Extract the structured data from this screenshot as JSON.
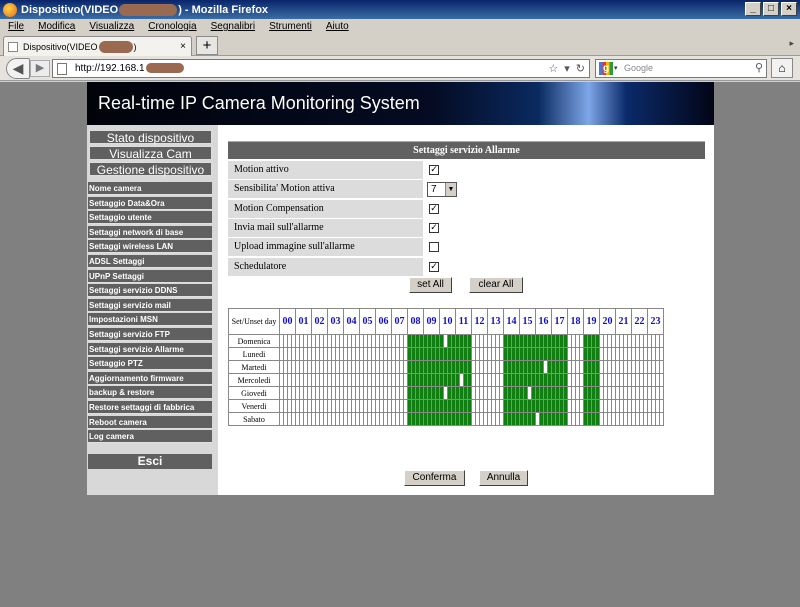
{
  "browser": {
    "title_prefix": "Dispositivo(VIDEO",
    "title_suffix": ") - Mozilla Firefox",
    "menu": [
      "File",
      "Modifica",
      "Visualizza",
      "Cronologia",
      "Segnalibri",
      "Strumenti",
      "Aiuto"
    ],
    "tab_label_prefix": "Dispositivo(VIDEO",
    "tab_label_suffix": ")",
    "newtab": "+",
    "url": "http://192.168.1",
    "search_placeholder": "Google"
  },
  "banner_title": "Real-time IP Camera Monitoring System",
  "sidebar": {
    "main_buttons": [
      "Stato dispositivo",
      "Visualizza Cam",
      "Gestione dispositivo"
    ],
    "items": [
      "Nome camera",
      "Settaggio Data&Ora",
      "Settaggio utente",
      "Settaggi network di base",
      "Settaggi wireless LAN",
      "ADSL Settaggi",
      "UPnP Settaggi",
      "Settaggi servizio DDNS",
      "Settaggi servizio mail",
      "Impostazioni MSN",
      "Settaggi servizio FTP",
      "Settaggi servizio Allarme",
      "Settaggio PTZ",
      "Aggiornamento firmware",
      "backup & restore",
      "Restore settaggi di fabbrica",
      "Reboot camera",
      "Log camera"
    ],
    "exit": "Esci"
  },
  "form": {
    "header": "Settaggi servizio Allarme",
    "rows": [
      {
        "label": "Motion attivo",
        "type": "checkbox",
        "checked": true
      },
      {
        "label": "Sensibilita' Motion attiva",
        "type": "select",
        "value": "7"
      },
      {
        "label": "Motion Compensation",
        "type": "checkbox",
        "checked": true
      },
      {
        "label": "Invia mail sull'allarme",
        "type": "checkbox",
        "checked": true
      },
      {
        "label": "Upload immagine sull'allarme",
        "type": "checkbox",
        "checked": false
      },
      {
        "label": "Schedulatore",
        "type": "checkbox",
        "checked": true
      }
    ],
    "set_all": "set All",
    "clear_all": "clear All",
    "confirm": "Conferma",
    "cancel": "Annulla"
  },
  "schedule": {
    "corner_label": "Set/Unset day",
    "hours": [
      "00",
      "01",
      "02",
      "03",
      "04",
      "05",
      "06",
      "07",
      "08",
      "09",
      "10",
      "11",
      "12",
      "13",
      "14",
      "15",
      "16",
      "17",
      "18",
      "19",
      "20",
      "21",
      "22",
      "23"
    ],
    "active_color": "#107e10",
    "days": [
      {
        "name": "Domenica",
        "active_hours": [
          8,
          9,
          10,
          11,
          14,
          15,
          16,
          17,
          19
        ],
        "unset_slots": [
          41
        ]
      },
      {
        "name": "Lunedi",
        "active_hours": [
          8,
          9,
          10,
          11,
          14,
          15,
          16,
          17,
          19
        ],
        "unset_slots": []
      },
      {
        "name": "Martedi",
        "active_hours": [
          8,
          9,
          10,
          11,
          14,
          15,
          16,
          17,
          19
        ],
        "unset_slots": [
          66
        ]
      },
      {
        "name": "Mercoledi",
        "active_hours": [
          8,
          9,
          10,
          11,
          14,
          15,
          16,
          17,
          19
        ],
        "unset_slots": [
          45
        ]
      },
      {
        "name": "Giovedi",
        "active_hours": [
          8,
          9,
          10,
          11,
          14,
          15,
          16,
          17,
          19
        ],
        "unset_slots": [
          41,
          62
        ]
      },
      {
        "name": "Venerdi",
        "active_hours": [
          8,
          9,
          10,
          11,
          14,
          15,
          16,
          17,
          19
        ],
        "unset_slots": []
      },
      {
        "name": "Sabato",
        "active_hours": [
          8,
          9,
          10,
          11,
          14,
          15,
          16,
          17,
          19
        ],
        "unset_slots": [
          64
        ]
      }
    ]
  }
}
